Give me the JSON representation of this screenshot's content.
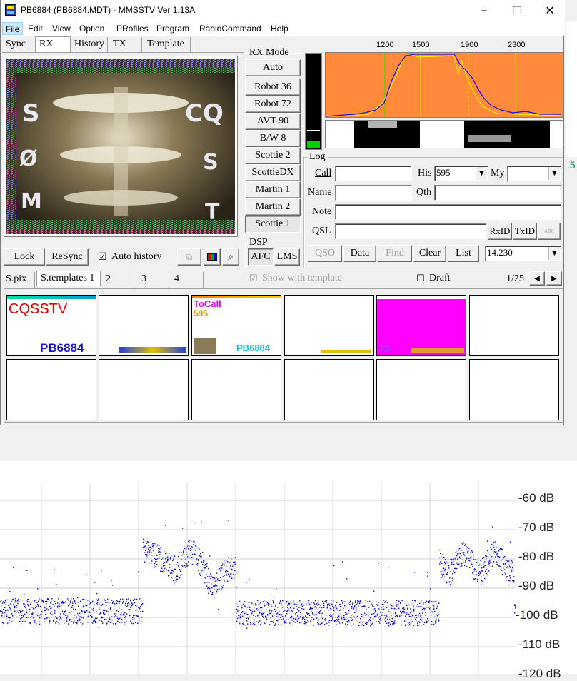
{
  "window": {
    "title": "PB6884 (PB6884.MDT) - MMSSTV Ver 1.13A",
    "minimize": "─",
    "maximize": "☐",
    "close": "✕"
  },
  "menu": [
    "File",
    "Edit",
    "View",
    "Option",
    "PRofiles",
    "Program",
    "RadioCommand",
    "Help"
  ],
  "tabs": [
    "Sync",
    "RX",
    "History",
    "TX",
    "Template"
  ],
  "rx_mode": {
    "label": "RX Mode",
    "modes": [
      "Auto",
      "Robot 36",
      "Robot 72",
      "AVT 90",
      "B/W 8",
      "Scottie 2",
      "ScottieDX",
      "Martin 1",
      "Martin 2",
      "Scottie 1"
    ],
    "selected": "Scottie 1"
  },
  "freq_scale": [
    "1200",
    "1500",
    "1900",
    "2300"
  ],
  "bottom_buttons": {
    "lock": "Lock",
    "resync": "ReSync",
    "auto_history": "Auto history",
    "auto_history_checked": "☑"
  },
  "dsp": {
    "label": "DSP",
    "afc": "AFC",
    "lms": "LMS"
  },
  "log": {
    "label": "Log",
    "call_label": "Call",
    "call_value": "",
    "his_label": "His",
    "his_value": "595",
    "my_label": "My",
    "my_value": "",
    "name_label": "Name",
    "name_value": "",
    "qth_label": "Qth",
    "qth_value": "",
    "note_label": "Note",
    "note_value": "",
    "qsl_label": "QSL",
    "qsl_value": "",
    "rxid": "RxID",
    "txid": "TxID",
    "abc": "ABC",
    "qso": "QSO",
    "data": "Data",
    "find": "Find",
    "clear": "Clear",
    "list": "List",
    "frequency": "14.230"
  },
  "template_tabs": [
    "S.pix",
    "S.templates 1",
    "2",
    "3",
    "4"
  ],
  "show_with_template": "Show with template",
  "draft": "Draft",
  "page_counter": "1/25",
  "page_prev": "◀",
  "page_next": "▶",
  "thumbs": {
    "t1_line1": "CQSSTV",
    "t1_line2": "PB6884",
    "t3_line1": "ToCall",
    "t3_line2": "595",
    "t3_line3": "PB6884",
    "t5_line1": "73"
  },
  "side_value": ".5",
  "spectrum": {
    "db_labels": [
      "-60 dB",
      "-70 dB",
      "-80 dB",
      "-90 dB",
      "-100 dB",
      "-110 dB",
      "-120 dB"
    ]
  },
  "colors": {
    "accent_orange": "#ff8a3c",
    "spectrum_blue": "#1010e0",
    "magenta": "#ff00ff"
  }
}
